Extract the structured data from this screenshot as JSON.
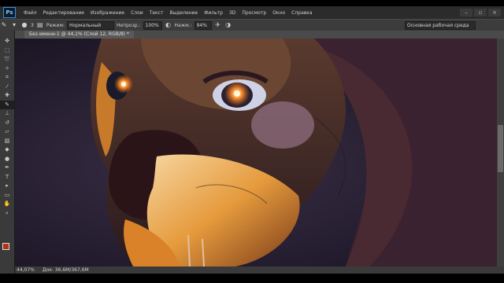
{
  "app": {
    "logo": "Ps"
  },
  "menu": [
    "Файл",
    "Редактирование",
    "Изображение",
    "Слои",
    "Текст",
    "Выделение",
    "Фильтр",
    "3D",
    "Просмотр",
    "Окно",
    "Справка"
  ],
  "options": {
    "mode_label": "Режим:",
    "mode_value": "Нормальный",
    "opacity_label": "Непрозр.:",
    "opacity_value": "100%",
    "flow_label": "Нажм.:",
    "flow_value": "94%",
    "brush_size": "3",
    "workspace": "Основная рабочая среда"
  },
  "document": {
    "tab_label": "Без имени-1 @ 44,1% (Слой 12, RGB/8) *"
  },
  "status": {
    "zoom": "44,07%",
    "doc_size": "Док: 36,6М/367,6М"
  },
  "colors": {
    "foreground": "#b7301a",
    "background": "#f0f0f0"
  },
  "tools": [
    "move-icon",
    "marquee-icon",
    "lasso-icon",
    "quick-select-icon",
    "crop-icon",
    "eyedropper-icon",
    "healing-icon",
    "brush-icon",
    "clone-stamp-icon",
    "history-brush-icon",
    "eraser-icon",
    "gradient-icon",
    "blur-icon",
    "dodge-icon",
    "pen-icon",
    "type-icon",
    "path-select-icon",
    "shape-icon",
    "hand-icon",
    "zoom-icon"
  ]
}
